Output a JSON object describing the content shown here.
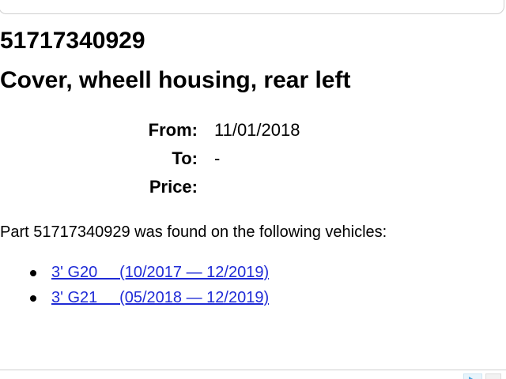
{
  "banner": {
    "left_text": "",
    "right_text": ""
  },
  "part": {
    "number": "51717340929",
    "name": "Cover, wheell housing, rear left"
  },
  "details": {
    "from_label": "From:",
    "from_value": "11/01/2018",
    "to_label": "To:",
    "to_value": "-",
    "price_label": "Price:",
    "price_value": ""
  },
  "found_text": "Part 51717340929 was found on the following vehicles:",
  "vehicles": [
    {
      "label": "3' G20     (10/2017 — 12/2019)"
    },
    {
      "label": "3' G21     (05/2018 — 12/2019)"
    }
  ],
  "colors": {
    "link": "#1f2bd6",
    "banner_accent": "#f0821e"
  }
}
